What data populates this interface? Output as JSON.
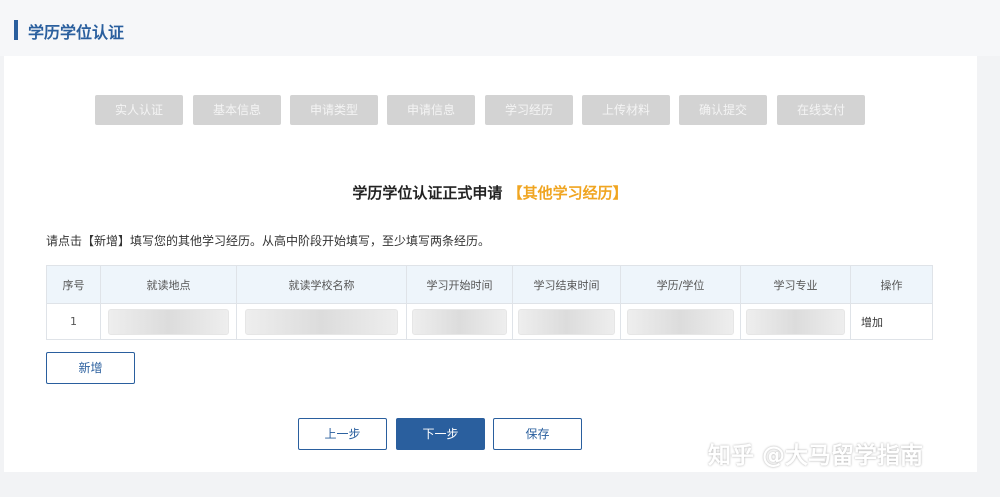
{
  "header": {
    "title": "学历学位认证"
  },
  "steps": [
    {
      "label": "实人认证"
    },
    {
      "label": "基本信息"
    },
    {
      "label": "申请类型"
    },
    {
      "label": "申请信息"
    },
    {
      "label": "学习经历"
    },
    {
      "label": "上传材料"
    },
    {
      "label": "确认提交"
    },
    {
      "label": "在线支付"
    }
  ],
  "form": {
    "title": "学历学位认证正式申请",
    "subtitle": "【其他学习经历】",
    "instruction": "请点击【新增】填写您的其他学习经历。从高中阶段开始填写，至少填写两条经历。"
  },
  "table": {
    "columns": [
      "序号",
      "就读地点",
      "就读学校名称",
      "学习开始时间",
      "学习结束时间",
      "学历/学位",
      "学习专业",
      "操作"
    ],
    "rows": [
      {
        "index": "1",
        "action": "增加"
      }
    ]
  },
  "buttons": {
    "add": "新增",
    "prev": "上一步",
    "next": "下一步",
    "save": "保存"
  },
  "watermark": "知乎 @大马留学指南",
  "colors": {
    "accent": "#2a5f9e",
    "highlight": "#f0a521",
    "step_disabled": "#d3d3d3"
  }
}
